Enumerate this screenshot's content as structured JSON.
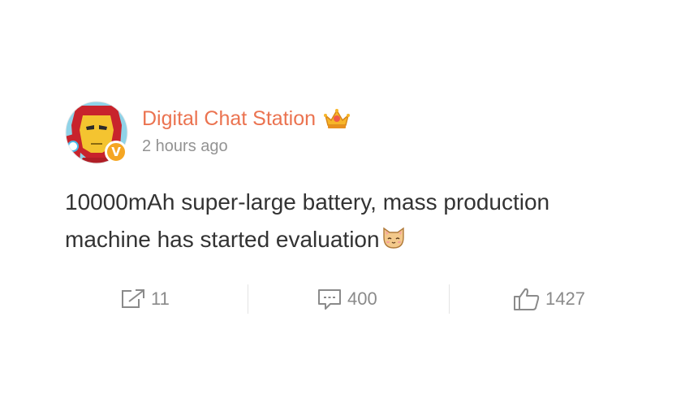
{
  "post": {
    "author": {
      "name": "Digital Chat Station",
      "verified_badge": "V",
      "avatar_icon": "iron-man-avatar-icon",
      "crown_icon": "crown-icon"
    },
    "timestamp": "2 hours ago",
    "text_lines": [
      "10000mAh super-large battery, mass production",
      "machine has started evaluation"
    ],
    "trailing_emoji": "cat-emoji-icon"
  },
  "actions": {
    "repost": {
      "icon": "repost-icon",
      "count": "11"
    },
    "comment": {
      "icon": "comment-icon",
      "count": "400"
    },
    "like": {
      "icon": "thumbs-up-icon",
      "count": "1427"
    }
  },
  "colors": {
    "username": "#eb7350",
    "badge": "#f5a623",
    "muted": "#939393",
    "body_text": "#333333"
  }
}
